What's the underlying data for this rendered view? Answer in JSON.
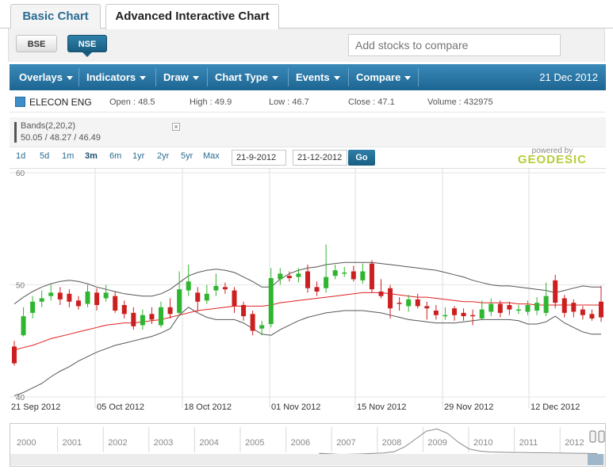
{
  "tabs": {
    "basic": "Basic Chart",
    "advanced": "Advanced Interactive Chart"
  },
  "exchange": {
    "bse": "BSE",
    "nse": "NSE",
    "selected": "NSE"
  },
  "compare": {
    "placeholder": "Add stocks to compare"
  },
  "toolbar": {
    "menus": [
      "Overlays",
      "Indicators",
      "Draw",
      "Chart Type",
      "Events",
      "Compare"
    ],
    "date": "21 Dec 2012"
  },
  "stock": {
    "name": "ELECON ENG",
    "open": "Open : 48.5",
    "high": "High : 49.9",
    "low": "Low : 46.7",
    "close": "Close : 47.1",
    "volume": "Volume : 432975",
    "color": "#3c8dc8"
  },
  "bands": {
    "title": "Bands(2,20,2)",
    "values": "50.05 / 48.27 / 46.49",
    "close": "×"
  },
  "periods": [
    "1d",
    "5d",
    "1m",
    "3m",
    "6m",
    "1yr",
    "2yr",
    "5yr",
    "Max"
  ],
  "active_period": "3m",
  "range": {
    "from": "21-9-2012",
    "to": "21-12-2012",
    "go": "Go",
    "dash": "–"
  },
  "branding": {
    "powered": "powered by",
    "name": "GEODESIC"
  },
  "navigator": {
    "years": [
      "2000",
      "2001",
      "2002",
      "2003",
      "2004",
      "2005",
      "2006",
      "2007",
      "2008",
      "2009",
      "2010",
      "2011",
      "2012"
    ]
  },
  "chart_data": {
    "type": "candlestick",
    "ylim": [
      40,
      60
    ],
    "yticks": [
      "60",
      "50",
      "40"
    ],
    "xlabels": [
      "21 Sep 2012",
      "05 Oct 2012",
      "18 Oct 2012",
      "01 Nov 2012",
      "15 Nov 2012",
      "29 Nov 2012",
      "12 Dec 2012"
    ],
    "colors": {
      "up": "#2fb52f",
      "down": "#cc1f1f",
      "mid": "#e02020",
      "band": "#555555"
    },
    "candles": [
      [
        44.5,
        43,
        45,
        42.8
      ],
      [
        45.5,
        47.2,
        48,
        45.4
      ],
      [
        47.5,
        48.5,
        49,
        47
      ],
      [
        48.5,
        48.8,
        49.5,
        48
      ],
      [
        49,
        49.3,
        50,
        48.6
      ],
      [
        49.3,
        48.7,
        49.8,
        48.2
      ],
      [
        49.2,
        48.5,
        49.6,
        48
      ],
      [
        48.6,
        48.1,
        49,
        47.8
      ],
      [
        48.3,
        49.4,
        50,
        48
      ],
      [
        49.3,
        48.2,
        49.7,
        47.7
      ],
      [
        48.8,
        49.3,
        50,
        48.5
      ],
      [
        49,
        47.7,
        49.4,
        47.5
      ],
      [
        48.2,
        47.4,
        48.6,
        47
      ],
      [
        47.5,
        46.3,
        48,
        46
      ],
      [
        46.4,
        47.3,
        47.8,
        46
      ],
      [
        47.4,
        46.9,
        48,
        46.5
      ],
      [
        46.4,
        48,
        48.5,
        46.2
      ],
      [
        48,
        47.4,
        48.8,
        47
      ],
      [
        47.5,
        49.6,
        51.2,
        47.2
      ],
      [
        49.5,
        50.3,
        51.8,
        49
      ],
      [
        49.3,
        48.5,
        49.8,
        47.6
      ],
      [
        48.6,
        49.2,
        50,
        48.3
      ],
      [
        49.5,
        49.9,
        51,
        49
      ],
      [
        49.8,
        49.6,
        50.2,
        49.2
      ],
      [
        49.5,
        48.1,
        49.8,
        47.5
      ],
      [
        48.2,
        47.2,
        48.5,
        46.8
      ],
      [
        47.4,
        45.9,
        47.7,
        45.5
      ],
      [
        46.1,
        46.4,
        46.8,
        45.5
      ],
      [
        46.5,
        50.6,
        51.5,
        46.2
      ],
      [
        50.5,
        51,
        51.5,
        50
      ],
      [
        50.8,
        50.6,
        51.2,
        50.3
      ],
      [
        50.7,
        51,
        51.5,
        50.2
      ],
      [
        51.2,
        49.7,
        51.8,
        49.3
      ],
      [
        49.8,
        49.4,
        50.3,
        49
      ],
      [
        49.7,
        50.7,
        53.6,
        49.3
      ],
      [
        50.8,
        51.3,
        51.8,
        50.5
      ],
      [
        51,
        51.1,
        51.6,
        50.7
      ],
      [
        51.2,
        50.5,
        51.7,
        50.3
      ],
      [
        50.4,
        51.2,
        51.9,
        50.1
      ],
      [
        51.9,
        49.6,
        52.2,
        49.3
      ],
      [
        49.4,
        49,
        50.5,
        48.8
      ],
      [
        49.7,
        47.9,
        50,
        47
      ],
      [
        48.4,
        48.3,
        48.9,
        47.7
      ],
      [
        48.1,
        48.7,
        49.1,
        47.6
      ],
      [
        48.7,
        48.1,
        49.2,
        47.9
      ],
      [
        48.1,
        47.9,
        48.5,
        46.9
      ],
      [
        47.7,
        47.3,
        48.2,
        46.9
      ],
      [
        47.3,
        47.3,
        48,
        46.9
      ],
      [
        47.9,
        47.3,
        48.1,
        46.8
      ],
      [
        47.5,
        47.2,
        47.9,
        46.8
      ],
      [
        47.3,
        47.2,
        47.8,
        46.4
      ],
      [
        47,
        47.8,
        48.6,
        46.9
      ],
      [
        47.6,
        48.3,
        48.8,
        47.2
      ],
      [
        48.3,
        47.5,
        48.6,
        47.1
      ],
      [
        48.2,
        47.8,
        48.5,
        47.3
      ],
      [
        47.8,
        47.8,
        48.2,
        47.4
      ],
      [
        47.6,
        48.2,
        48.6,
        47.3
      ],
      [
        47.7,
        48.4,
        48.9,
        47.3
      ],
      [
        47.5,
        49,
        50.2,
        47.2
      ],
      [
        50.4,
        48.4,
        50.9,
        47.9
      ],
      [
        48.8,
        47.5,
        49.1,
        47.1
      ],
      [
        48.4,
        47.6,
        48.7,
        47.1
      ],
      [
        47.8,
        47.3,
        48.1,
        46.9
      ],
      [
        47.4,
        47,
        47.8,
        46.8
      ],
      [
        48.5,
        47.1,
        49.9,
        46.7
      ]
    ],
    "middle_band": [
      44.2,
      44.4,
      44.6,
      44.9,
      45.2,
      45.4,
      45.6,
      45.8,
      46,
      46.2,
      46.4,
      46.5,
      46.6,
      46.6,
      46.7,
      46.8,
      46.9,
      47.1,
      47.3,
      47.5,
      47.7,
      47.8,
      47.9,
      48,
      48.1,
      48.1,
      48.1,
      48.1,
      48.2,
      48.4,
      48.5,
      48.6,
      48.7,
      48.8,
      48.9,
      49,
      49.1,
      49.2,
      49.3,
      49.3,
      49.3,
      49.2,
      49.1,
      49,
      48.9,
      48.9,
      48.8,
      48.7,
      48.6,
      48.5,
      48.5,
      48.4,
      48.4,
      48.4,
      48.4,
      48.3,
      48.3,
      48.2,
      48.2,
      48.2,
      48.2,
      48.2,
      48.2,
      48.2,
      48.2
    ],
    "upper_band": [
      48.3,
      48.9,
      49.4,
      49.8,
      50.1,
      50.3,
      50.4,
      50.3,
      50.1,
      49.8,
      49.6,
      49.4,
      49.2,
      49.1,
      49,
      49,
      49.2,
      49.6,
      50.2,
      50.8,
      51.1,
      51.3,
      51.4,
      51.3,
      51.1,
      50.7,
      50.3,
      49.8,
      49.8,
      50.5,
      51,
      51.3,
      51.5,
      51.6,
      51.8,
      51.9,
      52,
      52,
      52,
      52,
      51.9,
      51.8,
      51.7,
      51.6,
      51.5,
      51.4,
      51.3,
      51.1,
      50.9,
      50.7,
      50.4,
      50.2,
      50,
      49.9,
      49.9,
      49.8,
      49.7,
      49.6,
      49.5,
      49.3,
      49.5,
      49.7,
      49.9,
      49.8,
      49.8
    ],
    "lower_band": [
      40.1,
      40.4,
      40.8,
      41.2,
      41.8,
      42.3,
      42.7,
      43.2,
      43.6,
      44,
      44.3,
      44.6,
      44.8,
      45,
      45.2,
      45.4,
      45.7,
      46.1,
      47.3,
      48,
      47.5,
      47.1,
      46.9,
      46.9,
      46.9,
      46.6,
      46.1,
      45.6,
      45.5,
      46,
      46.4,
      46.8,
      47.1,
      47.3,
      47.5,
      47.6,
      47.7,
      47.7,
      47.7,
      47.6,
      47.5,
      47.3,
      47.1,
      46.9,
      46.8,
      46.7,
      46.6,
      46.6,
      46.6,
      46.7,
      46.8,
      46.9,
      46.9,
      46.9,
      46.9,
      46.8,
      46.5,
      46.5,
      46.7,
      47.2,
      46.6,
      46.2,
      45.8,
      45.6,
      45.6
    ],
    "navigator_series": [
      42,
      41.5,
      41,
      41.2,
      41.5,
      42,
      42.3,
      43.5,
      48,
      55,
      62,
      64,
      60,
      52,
      46,
      44,
      43.2,
      43,
      42.8,
      42.8,
      42.5,
      42.5,
      42.3,
      42.2,
      42.1,
      42,
      41.8
    ]
  }
}
